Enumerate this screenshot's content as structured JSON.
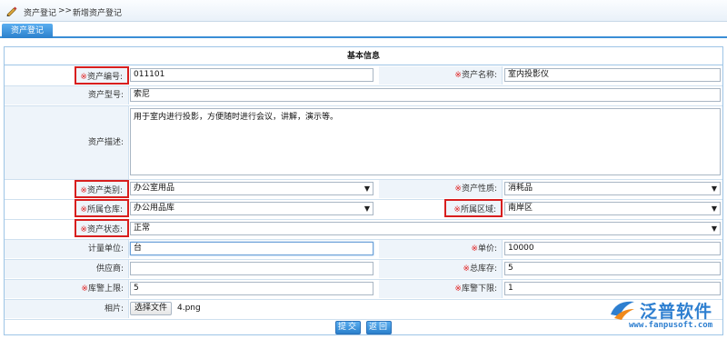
{
  "breadcrumb": {
    "item1": "资产登记",
    "sep": ">>",
    "item2": "新增资产登记"
  },
  "tab": {
    "label": "资产登记"
  },
  "form": {
    "section_title": "基本信息",
    "required_mark": "※",
    "asset_no": {
      "label": "资产编号:",
      "value": "011101"
    },
    "asset_name": {
      "label": "资产名称:",
      "value": "室内投影仪"
    },
    "asset_model": {
      "label": "资产型号:",
      "value": "索尼"
    },
    "asset_desc": {
      "label": "资产描述:",
      "value": "用于室内进行投影，方便随时进行会议，讲解，演示等。"
    },
    "asset_category": {
      "label": "资产类别:",
      "value": "办公室用品"
    },
    "asset_nature": {
      "label": "资产性质:",
      "value": "消耗品"
    },
    "warehouse": {
      "label": "所属仓库:",
      "value": "办公用品库"
    },
    "area": {
      "label": "所属区域:",
      "value": "南岸区"
    },
    "status": {
      "label": "资产状态:",
      "value": "正常"
    },
    "unit": {
      "label": "计量单位:",
      "value": "台"
    },
    "price": {
      "label": "单价:",
      "value": "10000"
    },
    "supplier": {
      "label": "供应商:",
      "value": ""
    },
    "total_stock": {
      "label": "总库存:",
      "value": "5"
    },
    "stock_upper": {
      "label": "库警上限:",
      "value": "5"
    },
    "stock_lower": {
      "label": "库警下限:",
      "value": "1"
    },
    "photo": {
      "label": "相片:",
      "button": "选择文件",
      "file": "4.png"
    }
  },
  "actions": {
    "submit": "提交",
    "back": "返回"
  },
  "watermark": {
    "brand": "泛普软件",
    "url": "www.fanpusoft.com"
  },
  "colors": {
    "accent": "#2a80cc",
    "required": "#e02020",
    "highlight_border": "#d81e1e",
    "label_bg": "#eef4fa"
  }
}
